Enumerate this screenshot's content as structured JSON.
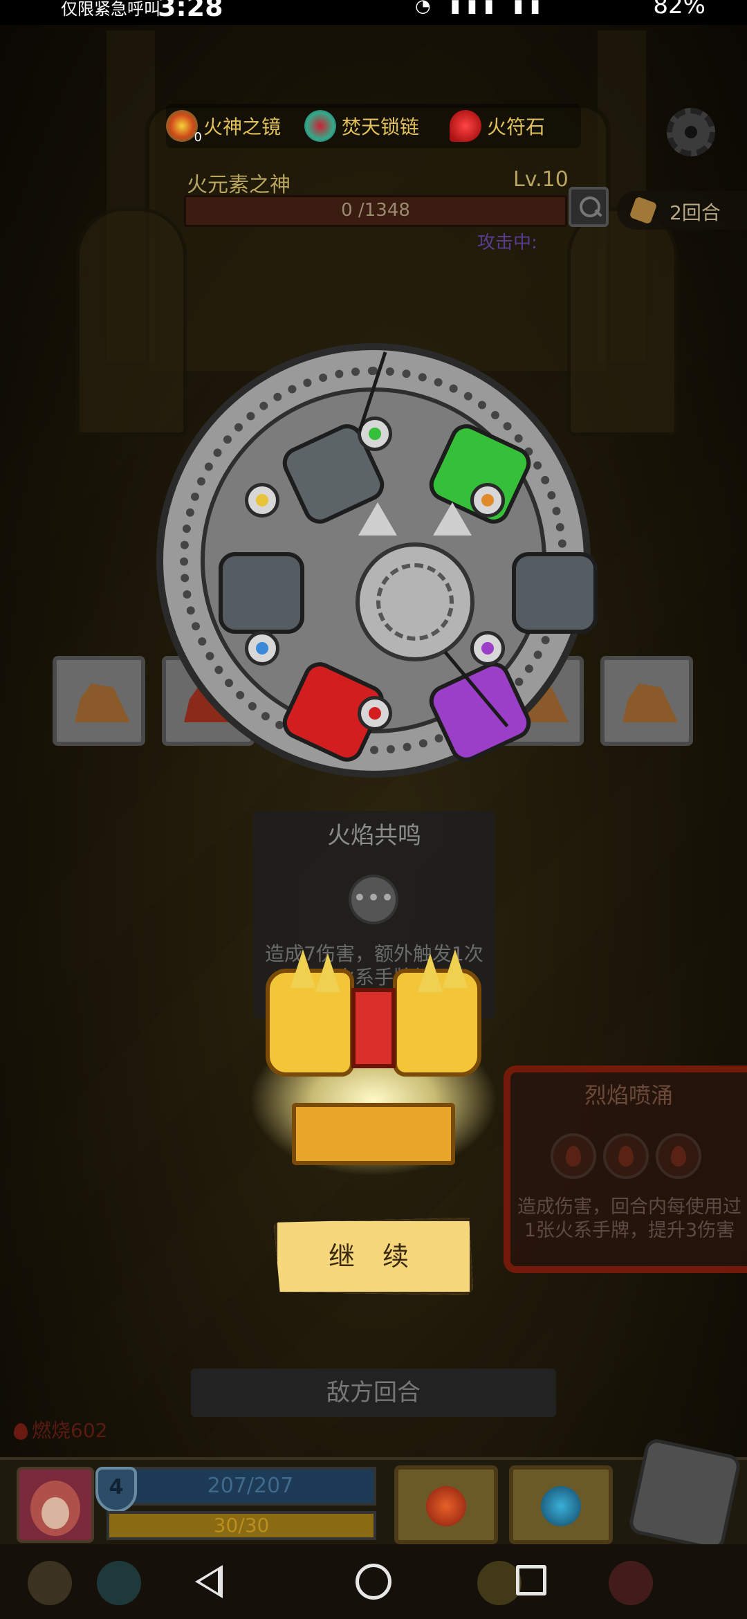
{
  "status_bar": {
    "carrier": "仅限紧急呼叫",
    "time": "3:28",
    "battery": "82%"
  },
  "relics": [
    {
      "label": "火神之镜",
      "count": "0",
      "icon": "fire-mirror-icon"
    },
    {
      "label": "焚天锁链",
      "icon": "chain-icon"
    },
    {
      "label": "火符石",
      "icon": "fire-rune-stone-icon"
    }
  ],
  "enemy": {
    "name": "火元素之神",
    "level": "Lv.10",
    "hp_text": "0 /1348",
    "round_text": "2回合",
    "intent_text": "攻击中:"
  },
  "skill_card": {
    "title": "火焰共鸣",
    "more": "•••",
    "description": "造成7伤害，额外触发1次名火系手牌效"
  },
  "burst_card": {
    "title": "烈焰喷涌",
    "description": "造成伤害，回合内每使用过1张火系手牌，提升3伤害"
  },
  "continue_label": "继 续",
  "enemy_turn_label": "敌方回合",
  "burn_status": "燃烧602",
  "player": {
    "shield": "4",
    "hp_text": "207/207",
    "mp_text": "30/30"
  },
  "colors": {
    "button_fill": "#f6d77c",
    "seg_green": "#36c03a",
    "seg_red": "#d21e1e",
    "seg_purple": "#9b3fc9"
  }
}
